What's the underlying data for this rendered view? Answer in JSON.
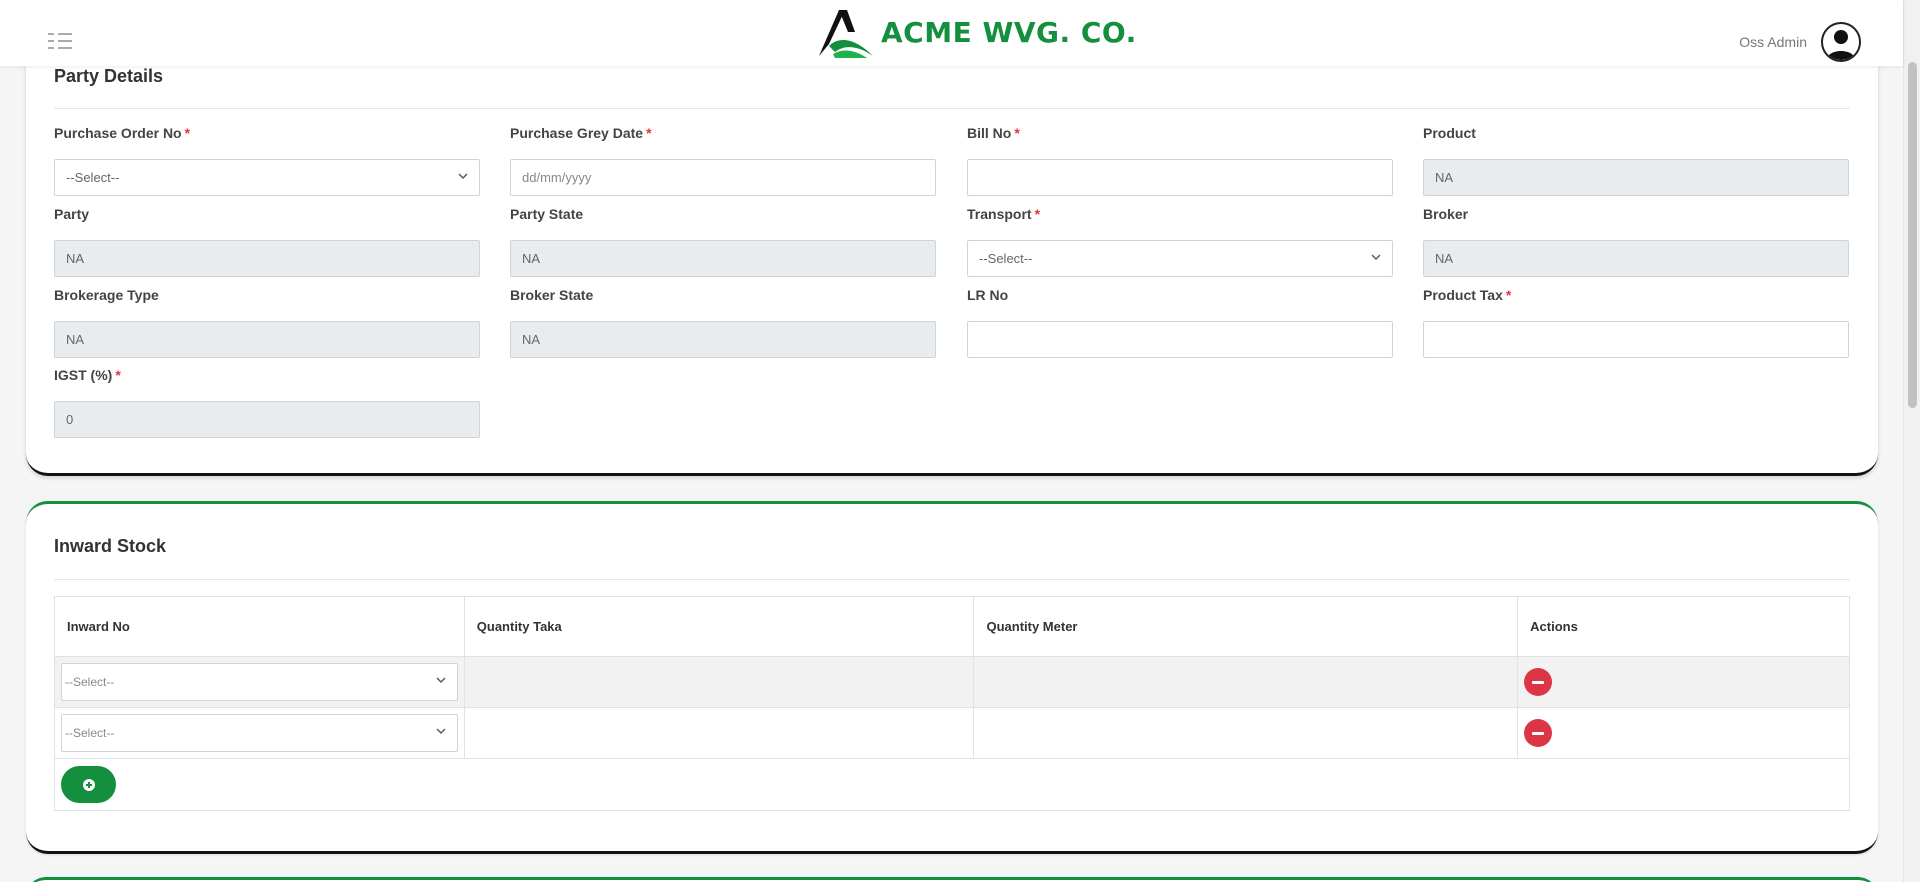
{
  "brand": {
    "name": "ACME WVG. CO."
  },
  "user": {
    "name": "Oss Admin"
  },
  "party_details": {
    "title": "Party Details",
    "fields": [
      {
        "label": "Purchase Order No",
        "required": "*",
        "type": "select",
        "value": "--Select--"
      },
      {
        "label": "Purchase Grey Date",
        "required": "*",
        "type": "date",
        "placeholder": "dd/mm/yyyy"
      },
      {
        "label": "Bill No",
        "required": "*",
        "type": "text",
        "value": ""
      },
      {
        "label": "Product",
        "required": "",
        "type": "readonly",
        "value": "NA"
      },
      {
        "label": "Party",
        "required": "",
        "type": "readonly",
        "value": "NA"
      },
      {
        "label": "Party State",
        "required": "",
        "type": "readonly",
        "value": "NA"
      },
      {
        "label": "Transport",
        "required": "*",
        "type": "select",
        "value": "--Select--"
      },
      {
        "label": "Broker",
        "required": "",
        "type": "readonly",
        "value": "NA"
      },
      {
        "label": "Brokerage Type",
        "required": "",
        "type": "readonly",
        "value": "NA"
      },
      {
        "label": "Broker State",
        "required": "",
        "type": "readonly",
        "value": "NA"
      },
      {
        "label": "LR No",
        "required": "",
        "type": "text",
        "value": ""
      },
      {
        "label": "Product Tax",
        "required": "*",
        "type": "text",
        "value": ""
      },
      {
        "label": "IGST (%)",
        "required": "*",
        "type": "readonly",
        "value": "0"
      }
    ]
  },
  "inward_stock": {
    "title": "Inward Stock",
    "columns": [
      "Inward No",
      "Quantity Taka",
      "Quantity Meter",
      "Actions"
    ],
    "rows": [
      {
        "inward_no": "--Select--",
        "quantity_taka": "",
        "quantity_meter": ""
      },
      {
        "inward_no": "--Select--",
        "quantity_taka": "",
        "quantity_meter": ""
      }
    ]
  },
  "colors": {
    "brand_green": "#138f3e",
    "danger_red": "#dc3545",
    "readonly_bg": "#e9ecef"
  },
  "icons": {
    "menu": "list-icon",
    "avatar": "user-avatar-icon",
    "remove": "minus-circle-icon",
    "add": "plus-circle-icon"
  }
}
